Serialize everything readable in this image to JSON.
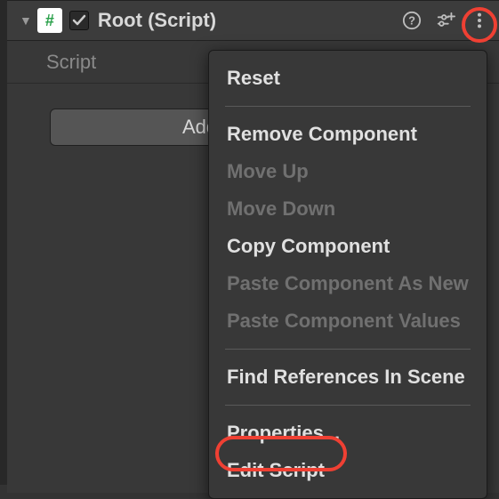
{
  "component": {
    "title": "Root (Script)",
    "enabled": true,
    "property_label": "Script"
  },
  "add_button_label": "Add Component",
  "menu": {
    "reset": "Reset",
    "remove": "Remove Component",
    "move_up": "Move Up",
    "move_down": "Move Down",
    "copy": "Copy Component",
    "paste_new": "Paste Component As New",
    "paste_values": "Paste Component Values",
    "find_refs": "Find References In Scene",
    "properties": "Properties...",
    "edit_script": "Edit Script"
  },
  "colors": {
    "highlight": "#ef4033"
  }
}
